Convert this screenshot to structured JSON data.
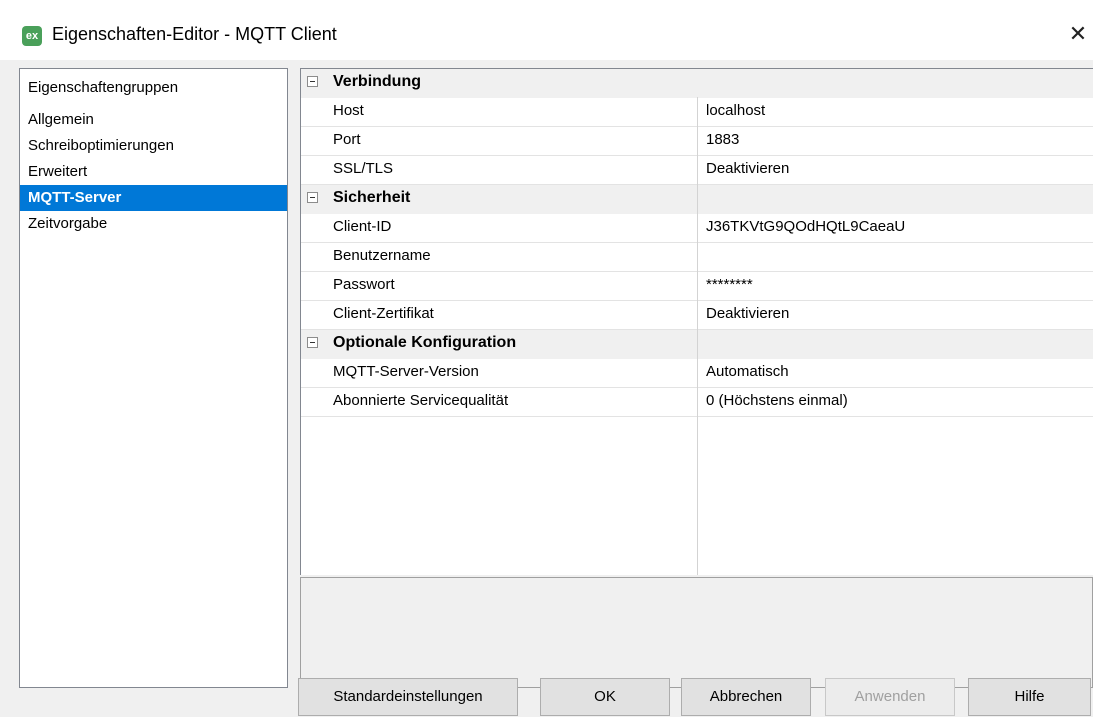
{
  "window": {
    "title": "Eigenschaften-Editor - MQTT Client",
    "icon_text": "ex",
    "close_glyph": "✕"
  },
  "groups": {
    "header": "Eigenschaftengruppen",
    "items": [
      {
        "label": "Allgemein",
        "selected": false
      },
      {
        "label": "Schreiboptimierungen",
        "selected": false
      },
      {
        "label": "Erweitert",
        "selected": false
      },
      {
        "label": "MQTT-Server",
        "selected": true
      },
      {
        "label": "Zeitvorgabe",
        "selected": false
      }
    ]
  },
  "grid": {
    "categories": [
      {
        "label": "Verbindung",
        "rows": [
          {
            "name": "Host",
            "value": "localhost"
          },
          {
            "name": "Port",
            "value": "1883"
          },
          {
            "name": "SSL/TLS",
            "value": "Deaktivieren"
          }
        ]
      },
      {
        "label": "Sicherheit",
        "rows": [
          {
            "name": "Client-ID",
            "value": "J36TKVtG9QOdHQtL9CaeaU"
          },
          {
            "name": "Benutzername",
            "value": ""
          },
          {
            "name": "Passwort",
            "value": "********"
          },
          {
            "name": "Client-Zertifikat",
            "value": "Deaktivieren"
          }
        ]
      },
      {
        "label": "Optionale Konfiguration",
        "rows": [
          {
            "name": "MQTT-Server-Version",
            "value": "Automatisch"
          },
          {
            "name": "Abonnierte Servicequalität",
            "value": "0 (Höchstens einmal)"
          }
        ]
      }
    ]
  },
  "buttons": {
    "defaults": "Standardeinstellungen",
    "ok": "OK",
    "cancel": "Abbrechen",
    "apply": "Anwenden",
    "help": "Hilfe"
  },
  "colors": {
    "selection": "#0078d7",
    "window_bg": "#f0f0f0",
    "app_icon": "#4aa05a"
  }
}
